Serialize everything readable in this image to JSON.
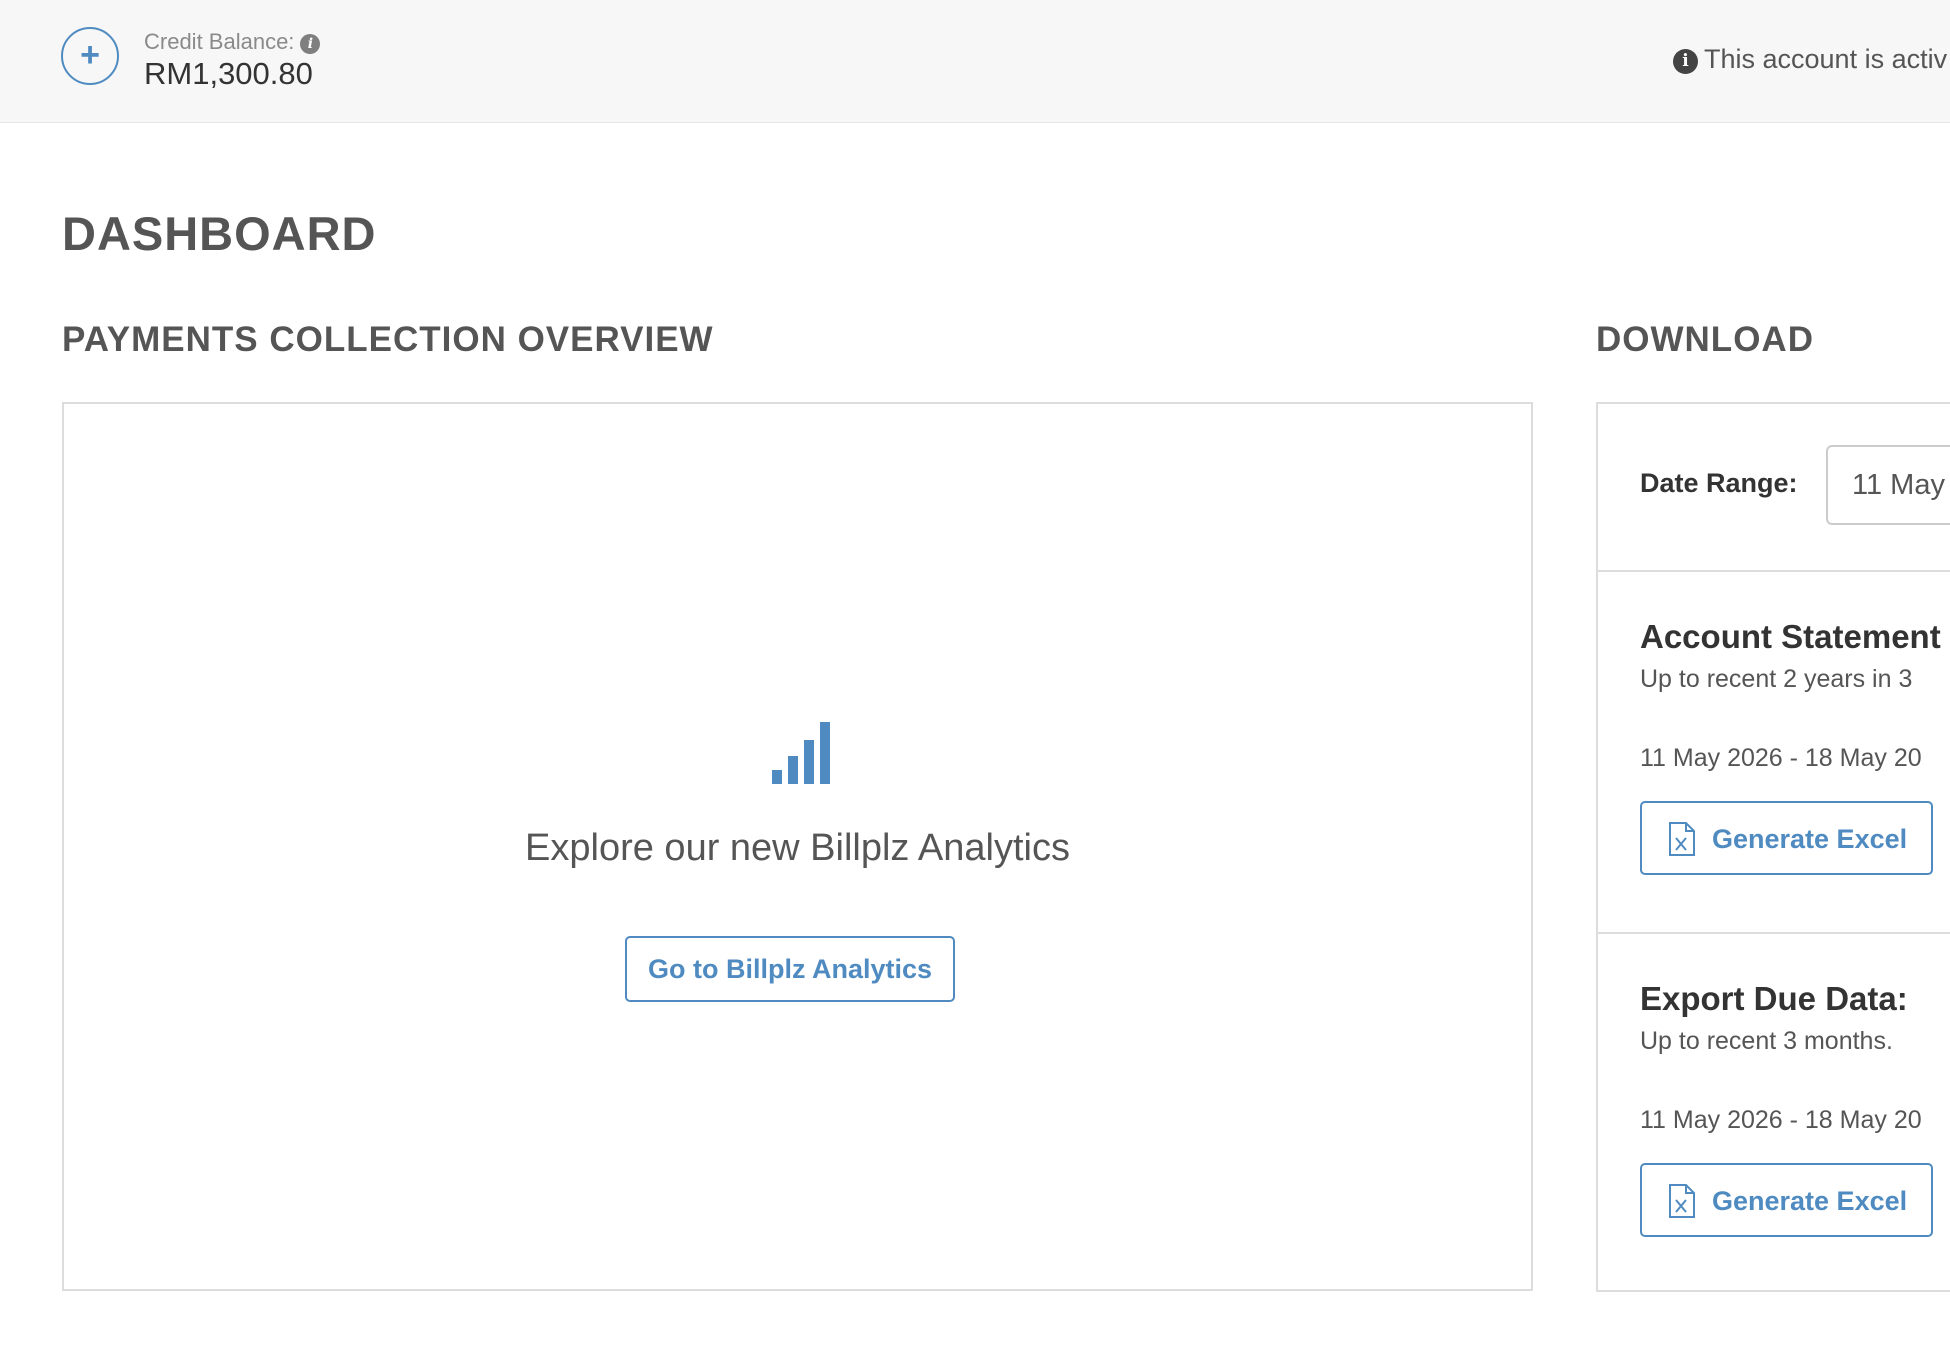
{
  "topbar": {
    "add_icon_glyph": "+",
    "credit_label": "Credit Balance:",
    "credit_value": "RM1,300.80",
    "info_glyph": "i",
    "account_notice": "This account is activ"
  },
  "page": {
    "title": "DASHBOARD"
  },
  "overview": {
    "title": "PAYMENTS COLLECTION OVERVIEW",
    "icon": "bar-chart-icon",
    "message": "Explore our new Billplz Analytics",
    "button_label": "Go to Billplz Analytics"
  },
  "download": {
    "title": "DOWNLOAD",
    "date_range_label": "Date Range:",
    "date_range_value": "11 May",
    "account_statement": {
      "heading": "Account Statement",
      "description": "Up to recent 2 years in 3",
      "range": "11 May 2026 - 18 May 20",
      "button_label": "Generate Excel"
    },
    "export_due": {
      "heading": "Export Due Data:",
      "description": "Up to recent 3 months.",
      "range": "11 May 2026 - 18 May 20",
      "button_label": "Generate Excel"
    }
  },
  "colors": {
    "accent": "#4f8bc0",
    "text": "#555555",
    "border": "#dcdcdc",
    "topbar_bg": "#f7f7f7"
  }
}
